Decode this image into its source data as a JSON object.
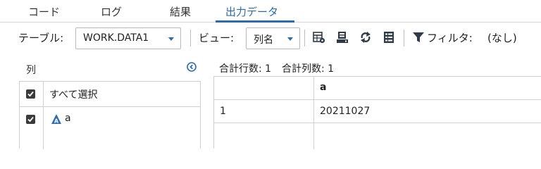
{
  "tabs": [
    {
      "label": "コード",
      "active": false
    },
    {
      "label": "ログ",
      "active": false
    },
    {
      "label": "結果",
      "active": false
    },
    {
      "label": "出力データ",
      "active": true
    }
  ],
  "toolbar": {
    "table_label": "テーブル:",
    "table_value": "WORK.DATA1",
    "view_label": "ビュー:",
    "view_value": "列名",
    "filter_label": "フィルタ:",
    "filter_value": "(なし)",
    "icons": [
      "table-properties-icon",
      "data-view-icon",
      "refresh-icon",
      "column-list-icon",
      "filter-icon"
    ]
  },
  "columns_panel": {
    "title": "列",
    "items": [
      {
        "label": "すべて選択",
        "checked": true,
        "type": "select-all"
      },
      {
        "label": "a",
        "checked": true,
        "type": "numeric",
        "type_icon": "numeric-type-icon"
      }
    ]
  },
  "results": {
    "total_rows_label": "合計行数: 1",
    "total_cols_label": "合計列数: 1",
    "headers": [
      "",
      "a"
    ],
    "rows": [
      [
        "1",
        "20211027"
      ]
    ]
  },
  "colors": {
    "accent": "#2a6bb3",
    "border": "#cfcfcf"
  }
}
